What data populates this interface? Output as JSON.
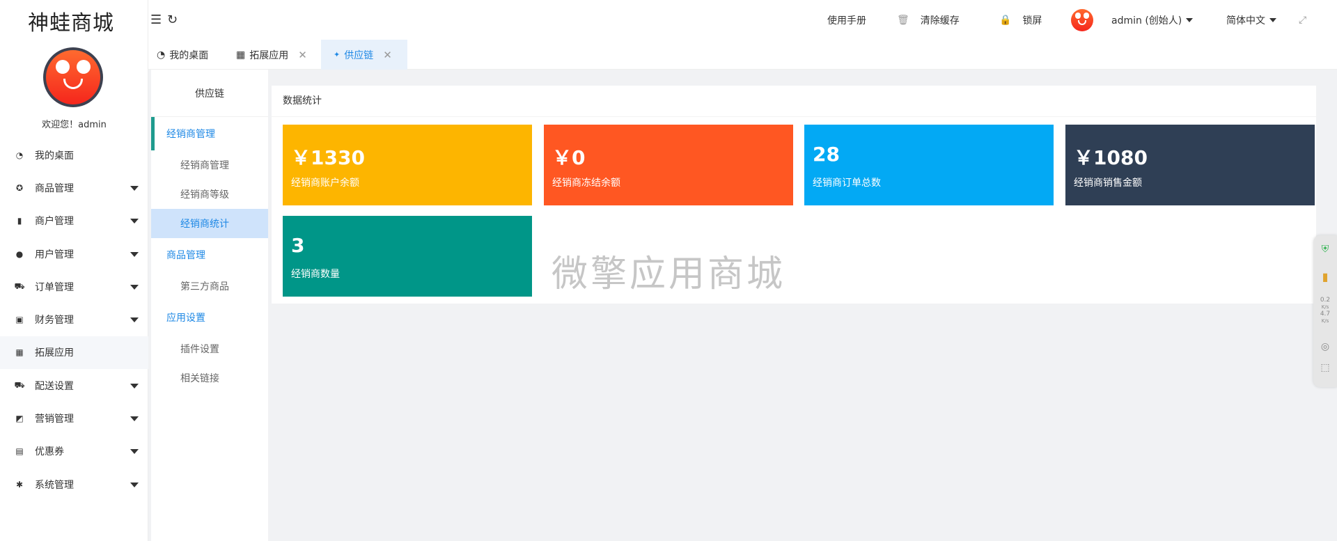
{
  "app": {
    "brand": "神蛙商城",
    "welcome": "欢迎您！admin"
  },
  "sidebar": {
    "items": [
      {
        "label": "我的桌面",
        "icon": "dashboard-icon",
        "glyph": "◔",
        "has_caret": false
      },
      {
        "label": "商品管理",
        "icon": "star-badge-icon",
        "glyph": "✪",
        "has_caret": true
      },
      {
        "label": "商户管理",
        "icon": "building-icon",
        "glyph": "▮",
        "has_caret": true
      },
      {
        "label": "用户管理",
        "icon": "user-icon",
        "glyph": "●",
        "has_caret": true
      },
      {
        "label": "订单管理",
        "icon": "cart-icon",
        "glyph": "⛟",
        "has_caret": true
      },
      {
        "label": "财务管理",
        "icon": "money-icon",
        "glyph": "▣",
        "has_caret": true
      },
      {
        "label": "拓展应用",
        "icon": "apps-icon",
        "glyph": "▦",
        "has_caret": false,
        "active": true
      },
      {
        "label": "配送设置",
        "icon": "truck-icon",
        "glyph": "⛟",
        "has_caret": true
      },
      {
        "label": "营销管理",
        "icon": "chart-icon",
        "glyph": "◩",
        "has_caret": true
      },
      {
        "label": "优惠券",
        "icon": "coupon-icon",
        "glyph": "▤",
        "has_caret": true
      },
      {
        "label": "系统管理",
        "icon": "gear-icon",
        "glyph": "✱",
        "has_caret": true
      }
    ]
  },
  "topbar": {
    "manual": "使用手册",
    "clear_cache": "清除缓存",
    "lock": "锁屏",
    "user": "admin (创始人)",
    "language": "简体中文"
  },
  "tabs": [
    {
      "label": "我的桌面",
      "icon": "dashboard-icon",
      "glyph": "◔",
      "closable": false
    },
    {
      "label": "拓展应用",
      "icon": "apps-icon",
      "glyph": "▦",
      "closable": true
    },
    {
      "label": "供应链",
      "icon": "diamond-icon",
      "glyph": "✦",
      "closable": true,
      "active": true
    }
  ],
  "subnav": {
    "title": "供应链",
    "group1": "经销商管理",
    "item1": "经销商管理",
    "item2": "经销商等级",
    "item3": "经销商统计",
    "group2": "商品管理",
    "item4": "第三方商品",
    "group3": "应用设置",
    "item5": "插件设置",
    "item6": "相关链接"
  },
  "panel": {
    "title": "数据统计",
    "watermark": "微擎应用商城",
    "cards": [
      {
        "value": "￥1330",
        "label": "经销商账户余额",
        "color": "#FDB500"
      },
      {
        "value": "￥0",
        "label": "经销商冻结余额",
        "color": "#FF5722"
      },
      {
        "value": "28",
        "label": "经销商订单总数",
        "color": "#03A9F4"
      },
      {
        "value": "￥1080",
        "label": "经销商销售金额",
        "color": "#2F3F55"
      },
      {
        "value": "3",
        "label": "经销商数量",
        "color": "#009688"
      }
    ]
  },
  "floatbar": {
    "net_up": "0.2",
    "net_down": "4.7",
    "unit": "K/s"
  }
}
